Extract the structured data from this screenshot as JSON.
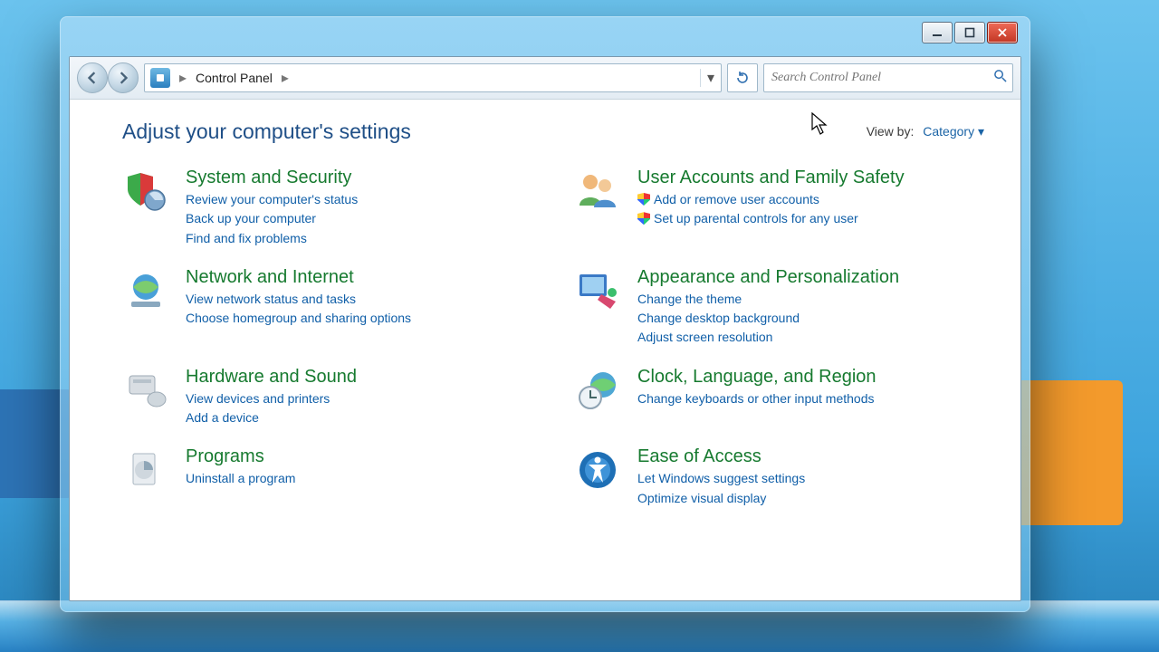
{
  "breadcrumb": {
    "root_label": "Control Panel"
  },
  "search": {
    "placeholder": "Search Control Panel"
  },
  "page": {
    "heading": "Adjust your computer's settings",
    "viewby_label": "View by:",
    "viewby_value": "Category"
  },
  "categories": {
    "system": {
      "title": "System and Security",
      "links": [
        "Review your computer's status",
        "Back up your computer",
        "Find and fix problems"
      ]
    },
    "users": {
      "title": "User Accounts and Family Safety",
      "links": [
        "Add or remove user accounts",
        "Set up parental controls for any user"
      ],
      "shielded": [
        true,
        true
      ]
    },
    "network": {
      "title": "Network and Internet",
      "links": [
        "View network status and tasks",
        "Choose homegroup and sharing options"
      ]
    },
    "appear": {
      "title": "Appearance and Personalization",
      "links": [
        "Change the theme",
        "Change desktop background",
        "Adjust screen resolution"
      ]
    },
    "hardware": {
      "title": "Hardware and Sound",
      "links": [
        "View devices and printers",
        "Add a device"
      ]
    },
    "clock": {
      "title": "Clock, Language, and Region",
      "links": [
        "Change keyboards or other input methods"
      ]
    },
    "programs": {
      "title": "Programs",
      "links": [
        "Uninstall a program"
      ]
    },
    "ease": {
      "title": "Ease of Access",
      "links": [
        "Let Windows suggest settings",
        "Optimize visual display"
      ]
    }
  }
}
